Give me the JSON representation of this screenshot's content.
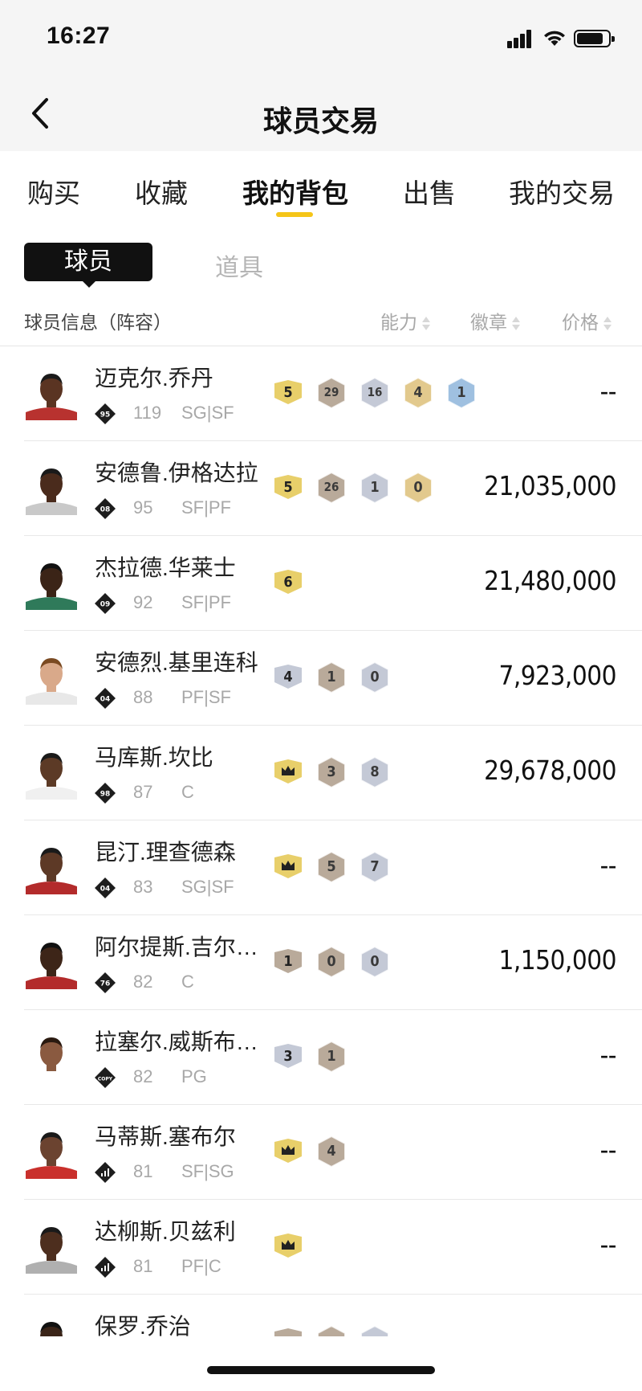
{
  "status_bar": {
    "time": "16:27"
  },
  "nav": {
    "title": "球员交易"
  },
  "tabs": [
    {
      "label": "购买",
      "active": false
    },
    {
      "label": "收藏",
      "active": false
    },
    {
      "label": "我的背包",
      "active": true
    },
    {
      "label": "出售",
      "active": false
    },
    {
      "label": "我的交易",
      "active": false
    }
  ],
  "segment": {
    "player": "球员",
    "props": "道具",
    "selected": "球员"
  },
  "columns": {
    "info": "球员信息（阵容）",
    "ability": "能力",
    "badge": "徽章",
    "price": "价格"
  },
  "colors": {
    "accent": "#f5c518",
    "gold": "#e8cf6a",
    "bronze": "#b9aa9a",
    "silver": "#c4c9d6",
    "hof": "#e2c98d",
    "blue": "#9fc0e0"
  },
  "players": [
    {
      "name": "迈克尔.乔丹",
      "tier": "95",
      "rating": "119",
      "position": "SG|SF",
      "price": "--",
      "badges": [
        {
          "type": "shield-gold",
          "label": "5"
        },
        {
          "type": "hex-bronze",
          "label": "29"
        },
        {
          "type": "hex-silver",
          "label": "16"
        },
        {
          "type": "hex-hof",
          "label": "4"
        },
        {
          "type": "hex-blue",
          "label": "1"
        }
      ]
    },
    {
      "name": "安德鲁.伊格达拉",
      "tier": "08",
      "rating": "95",
      "position": "SF|PF",
      "price": "21,035,000",
      "badges": [
        {
          "type": "shield-gold",
          "label": "5"
        },
        {
          "type": "hex-bronze",
          "label": "26"
        },
        {
          "type": "hex-silver",
          "label": "1"
        },
        {
          "type": "hex-hof",
          "label": "0"
        }
      ]
    },
    {
      "name": "杰拉德.华莱士",
      "tier": "09",
      "rating": "92",
      "position": "SF|PF",
      "price": "21,480,000",
      "badges": [
        {
          "type": "shield-gold",
          "label": "6"
        }
      ]
    },
    {
      "name": "安德烈.基里连科",
      "tier": "04",
      "rating": "88",
      "position": "PF|SF",
      "price": "7,923,000",
      "badges": [
        {
          "type": "shield-silver",
          "label": "4"
        },
        {
          "type": "hex-bronze",
          "label": "1"
        },
        {
          "type": "hex-silver",
          "label": "0"
        }
      ]
    },
    {
      "name": "马库斯.坎比",
      "tier": "98",
      "rating": "87",
      "position": "C",
      "price": "29,678,000",
      "badges": [
        {
          "type": "shield-gold-crown",
          "label": ""
        },
        {
          "type": "hex-bronze",
          "label": "3"
        },
        {
          "type": "hex-silver",
          "label": "8"
        }
      ]
    },
    {
      "name": "昆汀.理查德森",
      "tier": "04",
      "rating": "83",
      "position": "SG|SF",
      "price": "--",
      "badges": [
        {
          "type": "shield-gold-crown",
          "label": ""
        },
        {
          "type": "hex-bronze",
          "label": "5"
        },
        {
          "type": "hex-silver",
          "label": "7"
        }
      ]
    },
    {
      "name": "阿尔提斯.吉尔…",
      "tier": "76",
      "rating": "82",
      "position": "C",
      "price": "1,150,000",
      "badges": [
        {
          "type": "shield-bronze",
          "label": "1"
        },
        {
          "type": "hex-bronze",
          "label": "0"
        },
        {
          "type": "hex-silver",
          "label": "0"
        }
      ]
    },
    {
      "name": "拉塞尔.威斯布…",
      "tier": "COPY",
      "rating": "82",
      "position": "PG",
      "price": "--",
      "badges": [
        {
          "type": "shield-silver",
          "label": "3"
        },
        {
          "type": "hex-bronze",
          "label": "1"
        }
      ]
    },
    {
      "name": "马蒂斯.塞布尔",
      "tier": "bars",
      "rating": "81",
      "position": "SF|SG",
      "price": "--",
      "badges": [
        {
          "type": "shield-gold-crown",
          "label": ""
        },
        {
          "type": "hex-bronze",
          "label": "4"
        }
      ]
    },
    {
      "name": "达柳斯.贝兹利",
      "tier": "bars",
      "rating": "81",
      "position": "PF|C",
      "price": "--",
      "badges": [
        {
          "type": "shield-gold-crown",
          "label": ""
        }
      ]
    },
    {
      "name": "保罗.乔治",
      "tier": "",
      "rating": "",
      "position": "",
      "price": "",
      "badges": [
        {
          "type": "shield-bronze",
          "label": ""
        },
        {
          "type": "hex-bronze",
          "label": ""
        },
        {
          "type": "hex-silver",
          "label": ""
        }
      ]
    }
  ]
}
